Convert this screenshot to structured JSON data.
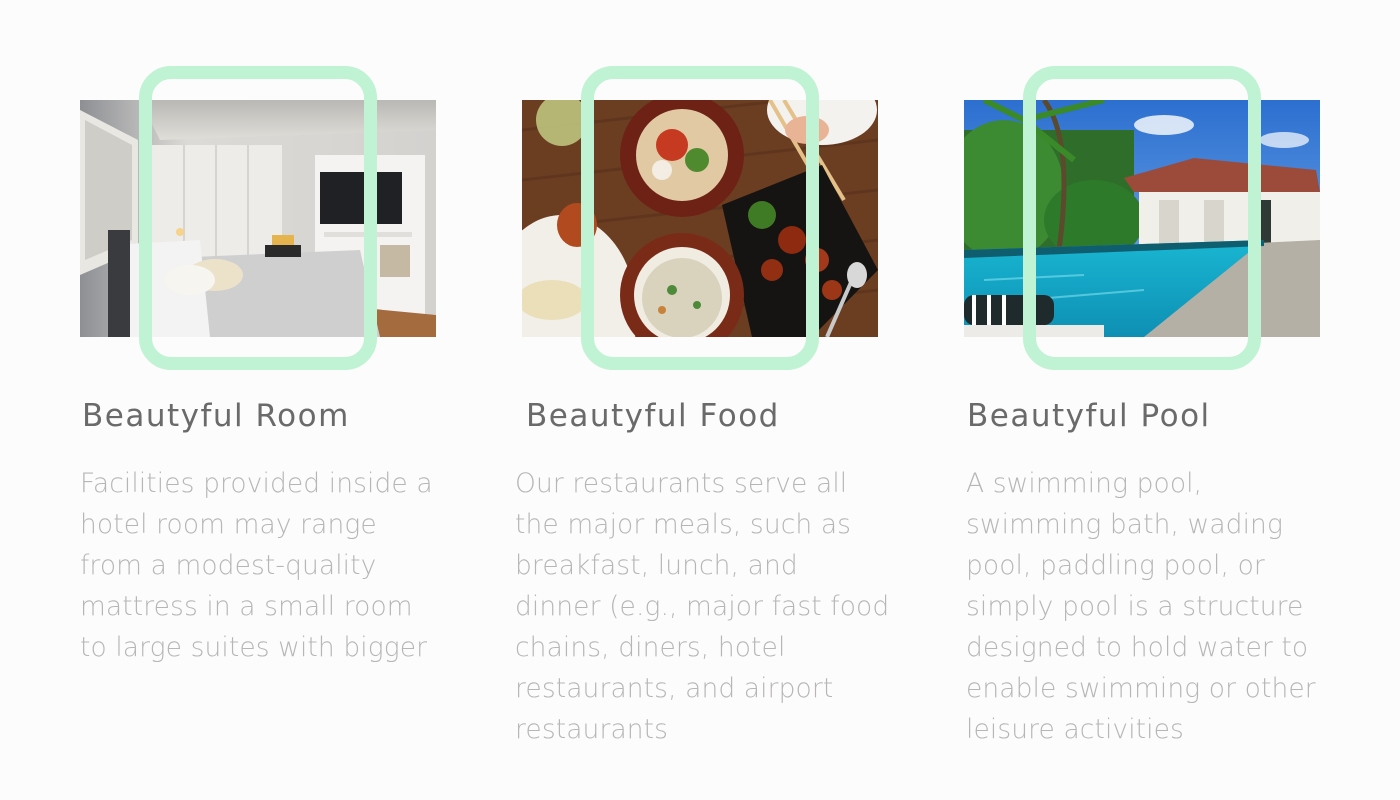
{
  "features": [
    {
      "title": "Beautyful Room",
      "text": "Facilities provided inside a\nhotel room may range\nfrom a modest-quality\nmattress in a small room\nto large suites with bigger",
      "image_alt": "hotel bedroom photo"
    },
    {
      "title": "Beautyful Food",
      "text": "Our restaurants serve all\nthe major meals, such as\nbreakfast, lunch, and\ndinner (e.g., major fast food\nchains, diners, hotel\nrestaurants, and airport\nrestaurants",
      "image_alt": "restaurant food photo"
    },
    {
      "title": "Beautyful Pool",
      "text": "A swimming pool,\nswimming bath, wading\npool, paddling pool, or\nsimply pool is a structure\ndesigned to hold water to\nenable swimming or other\nleisure activities",
      "image_alt": "swimming pool photo"
    }
  ],
  "colors": {
    "background": "#fdfcfc",
    "frame_accent": "#c0f2d4",
    "title": "#6a6a6a",
    "body_text": "#b6b6b6"
  }
}
